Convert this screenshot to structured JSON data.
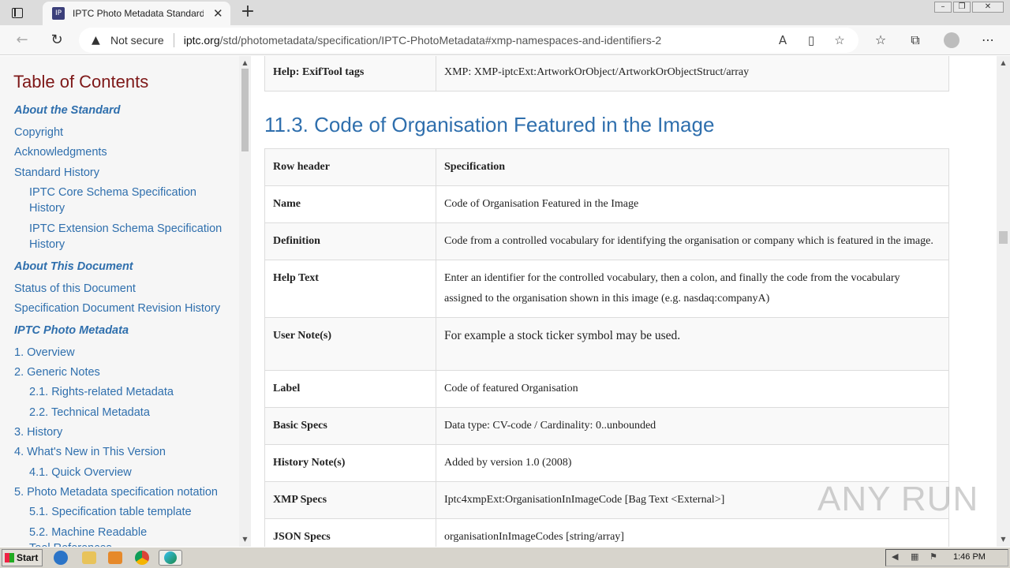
{
  "browser": {
    "tab_title": "IPTC Photo Metadata Standard",
    "tab_close": "✕",
    "new_tab": "+",
    "security_label": "Not secure",
    "url_host": "iptc.org",
    "url_path": "/std/photometadata/specification/IPTC-PhotoMetadata#xmp-namespaces-and-identifiers-2",
    "favicon_text": "IP"
  },
  "toc": {
    "heading": "Table of Contents",
    "items": [
      {
        "label": "About the Standard"
      },
      {
        "label": "Copyright"
      },
      {
        "label": "Acknowledgments"
      },
      {
        "label": "Standard History"
      },
      {
        "label": "IPTC Core Schema Specification"
      },
      {
        "label": "History"
      },
      {
        "label": "IPTC Extension Schema Specification"
      },
      {
        "label": "History"
      },
      {
        "label": "About This Document"
      },
      {
        "label": "Status of this Document"
      },
      {
        "label": "Specification Document Revision History"
      },
      {
        "label": "IPTC Photo Metadata"
      },
      {
        "label": "1. Overview"
      },
      {
        "label": "2. Generic Notes"
      },
      {
        "label": "2.1. Rights-related Metadata"
      },
      {
        "label": "2.2. Technical Metadata"
      },
      {
        "label": "3. History"
      },
      {
        "label": "4. What's New in This Version"
      },
      {
        "label": "4.1. Quick Overview"
      },
      {
        "label": "5. Photo Metadata specification notation"
      },
      {
        "label": "5.1. Specification table template"
      },
      {
        "label": "5.2. Machine Readable"
      },
      {
        "label": "Tool References"
      }
    ]
  },
  "top_table": {
    "key": "Help: ExifTool tags",
    "value": "XMP: XMP-iptcExt:ArtworkOrObject/ArtworkOrObjectStruct/array"
  },
  "section_title": "11.3. Code of Organisation Featured in the Image",
  "spec_table": {
    "rows": [
      {
        "key": "Row header",
        "value": "Specification"
      },
      {
        "key": "Name",
        "value": "Code of Organisation Featured in the Image"
      },
      {
        "key": "Definition",
        "value": "Code from a controlled vocabulary for identifying the organisation or company which is featured in the image."
      },
      {
        "key": "Help Text",
        "value": "Enter an identifier for the controlled vocabulary, then a colon, and finally the code from the vocabulary assigned to the organisation shown in this image (e.g. nasdaq:companyA)"
      },
      {
        "key": "User Note(s)",
        "value": "For example a stock ticker symbol may be used."
      },
      {
        "key": "Label",
        "value": "Code of featured Organisation"
      },
      {
        "key": "Basic Specs",
        "value": "Data type: CV-code / Cardinality: 0..unbounded"
      },
      {
        "key": "History Note(s)",
        "value": "Added by version 1.0 (2008)"
      },
      {
        "key": "XMP Specs",
        "value": "Iptc4xmpExt:OrganisationInImageCode [Bag Text <External>]"
      },
      {
        "key": "JSON Specs",
        "value": "organisationInImageCodes [string/array]"
      }
    ]
  },
  "watermark": "ANY RUN",
  "taskbar": {
    "start_label": "Start",
    "clock": "1:46 PM"
  }
}
